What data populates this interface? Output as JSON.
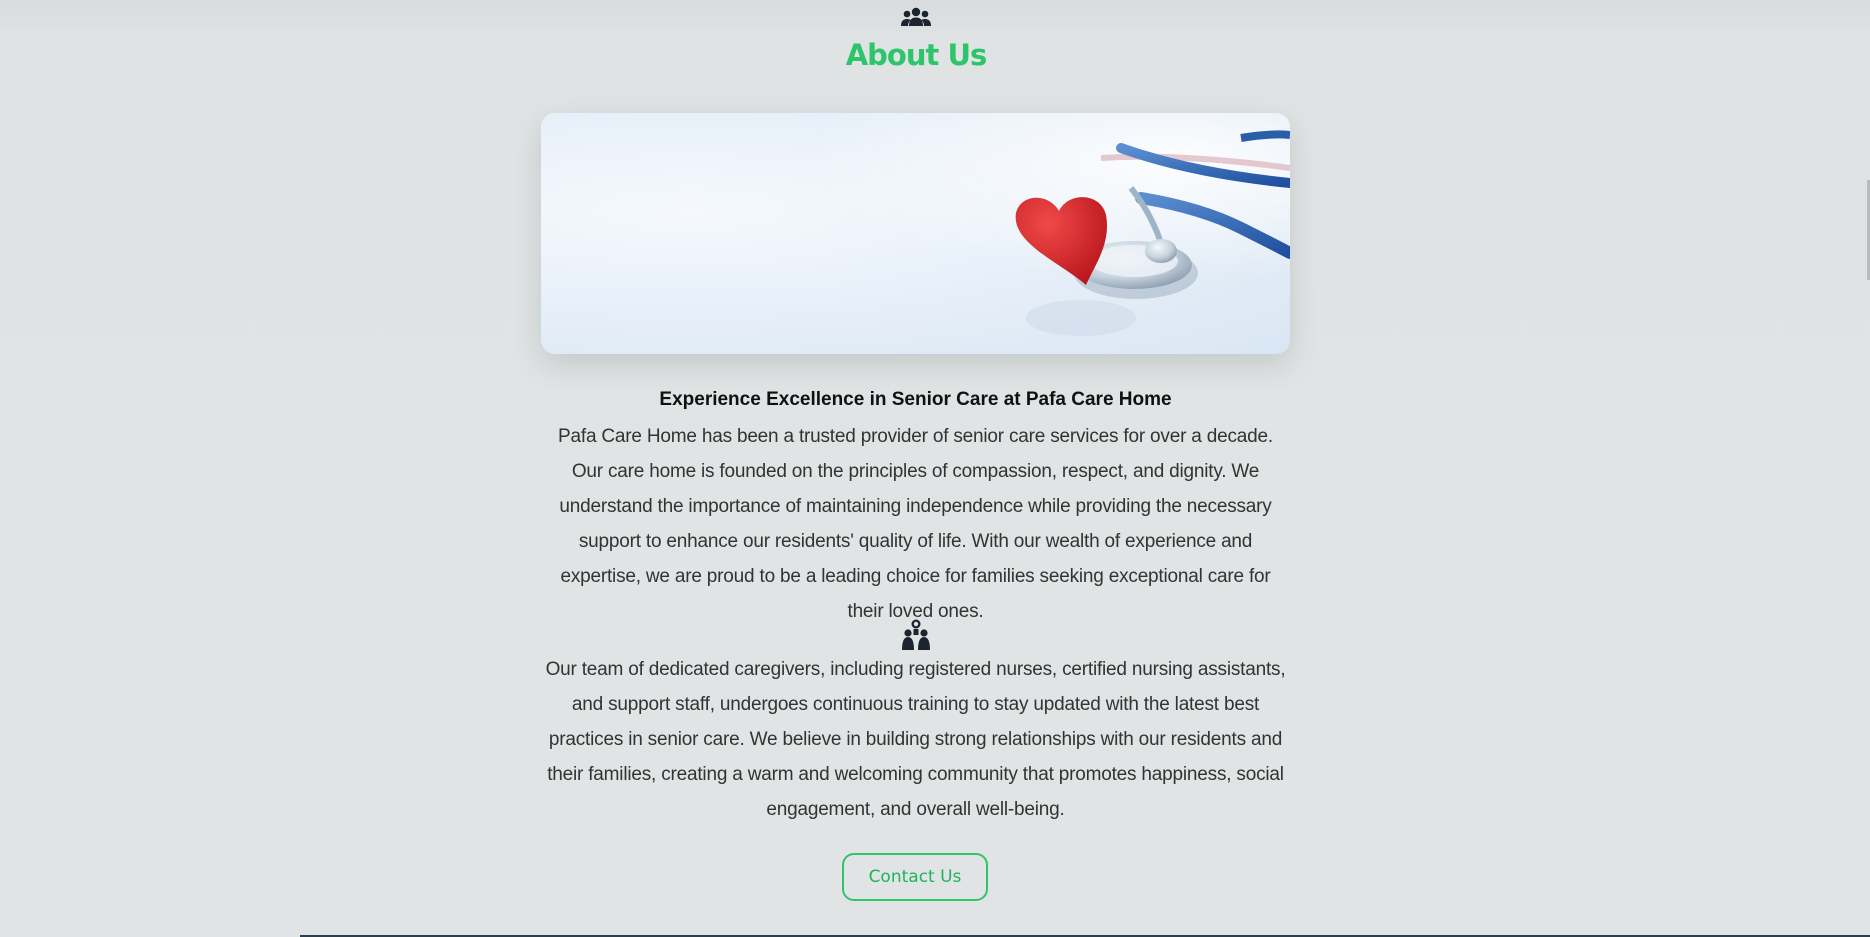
{
  "about": {
    "top_icon": "users-group-icon",
    "title": "About Us",
    "hero_image": "heart-and-stethoscope-image",
    "subtitle": "Experience Excellence in Senior Care at Pafa Care Home",
    "paragraph1": "Pafa Care Home has been a trusted provider of senior care services for over a decade. Our care home is founded on the principles of compassion, respect, and dignity. We understand the importance of maintaining independence while providing the necessary support to enhance our residents' quality of life. With our wealth of experience and expertise, we are proud to be a leading choice for families seeking exceptional care for their loved ones.",
    "team_icon": "caregivers-team-icon",
    "paragraph2": "Our team of dedicated caregivers, including registered nurses, certified nursing assistants, and support staff, undergoes continuous training to stay updated with the latest best practices in senior care. We believe in building strong relationships with our residents and their families, creating a warm and welcoming community that promotes happiness, social engagement, and overall well-being.",
    "contact_button": "Contact Us"
  },
  "colors": {
    "accent": "#2ec46a",
    "background": "#dfe3e3",
    "text": "#333333",
    "heading": "#111111"
  }
}
